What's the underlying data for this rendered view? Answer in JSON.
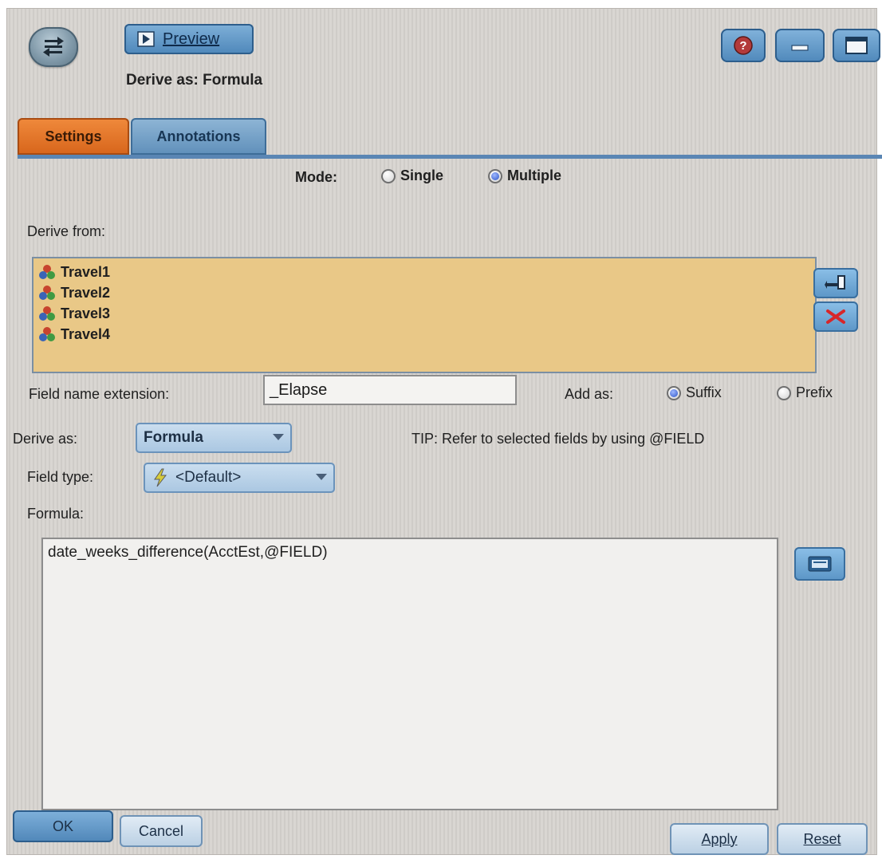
{
  "header": {
    "preview_label": "Preview",
    "title": "Derive as: Formula"
  },
  "tabs": [
    {
      "label": "Settings",
      "active": true
    },
    {
      "label": "Annotations",
      "active": false
    }
  ],
  "mode": {
    "label": "Mode:",
    "options": [
      "Single",
      "Multiple"
    ],
    "selected": "Multiple"
  },
  "derive_from": {
    "label": "Derive from:",
    "items": [
      "Travel1",
      "Travel2",
      "Travel3",
      "Travel4"
    ]
  },
  "field_name_extension": {
    "label": "Field name extension:",
    "value": "_Elapse"
  },
  "add_as": {
    "label": "Add as:",
    "options": [
      "Suffix",
      "Prefix"
    ],
    "selected": "Suffix"
  },
  "derive_as": {
    "label": "Derive as:",
    "value": "Formula"
  },
  "tip": "TIP: Refer to selected fields by using @FIELD",
  "field_type": {
    "label": "Field type:",
    "value": "<Default>"
  },
  "formula": {
    "label": "Formula:",
    "value": "date_weeks_difference(AcctEst,@FIELD)"
  },
  "buttons": {
    "ok": "OK",
    "cancel": "Cancel",
    "apply": "Apply",
    "reset": "Reset"
  },
  "colors": {
    "settings_tab": "#e0702a",
    "list_bg": "#e9c887",
    "accent_blue": "#5b8fc0"
  }
}
